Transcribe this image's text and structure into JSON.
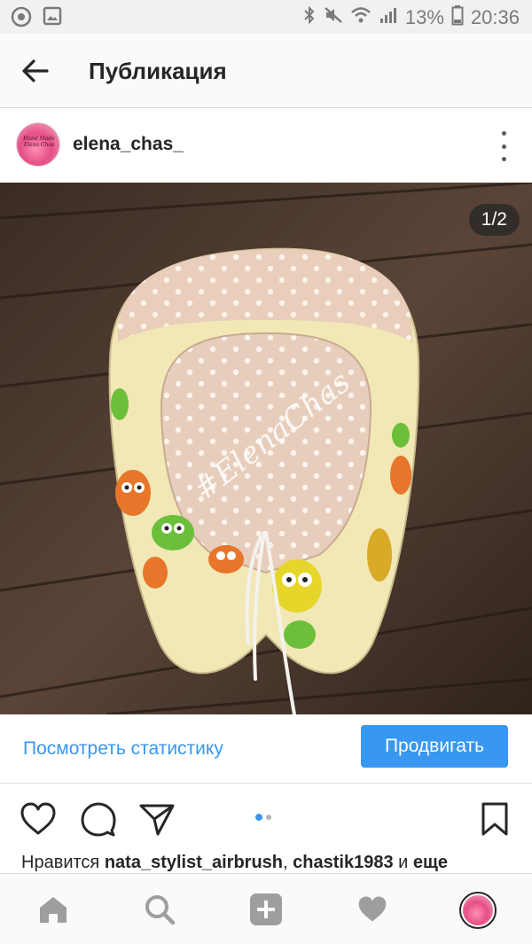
{
  "status_bar": {
    "battery_percent": "13%",
    "time": "20:36",
    "left_icons": [
      "app-notification-icon",
      "image-notification-icon"
    ],
    "right_icons": [
      "bluetooth-icon",
      "mute-icon",
      "wifi-icon",
      "signal-icon",
      "battery-icon"
    ]
  },
  "header": {
    "title": "Публикация"
  },
  "post": {
    "username": "elena_chas_",
    "avatar_text": "Hand Made Elena Chas",
    "image_counter": "1/2",
    "watermark": "#ElenaChas",
    "carousel": {
      "current": 1,
      "total": 2
    }
  },
  "insights": {
    "stats_link": "Посмотреть статистику",
    "promote_label": "Продвигать"
  },
  "likes": {
    "prefix": "Нравится",
    "user1": "nata_stylist_airbrush",
    "separator": ",",
    "user2": "chastik1983",
    "conjunction": "и",
    "more": "еще"
  },
  "colors": {
    "accent": "#3897f0",
    "text": "#262626",
    "nav_icon": "#9e9e9e",
    "dot_inactive": "#b4b4b4"
  }
}
